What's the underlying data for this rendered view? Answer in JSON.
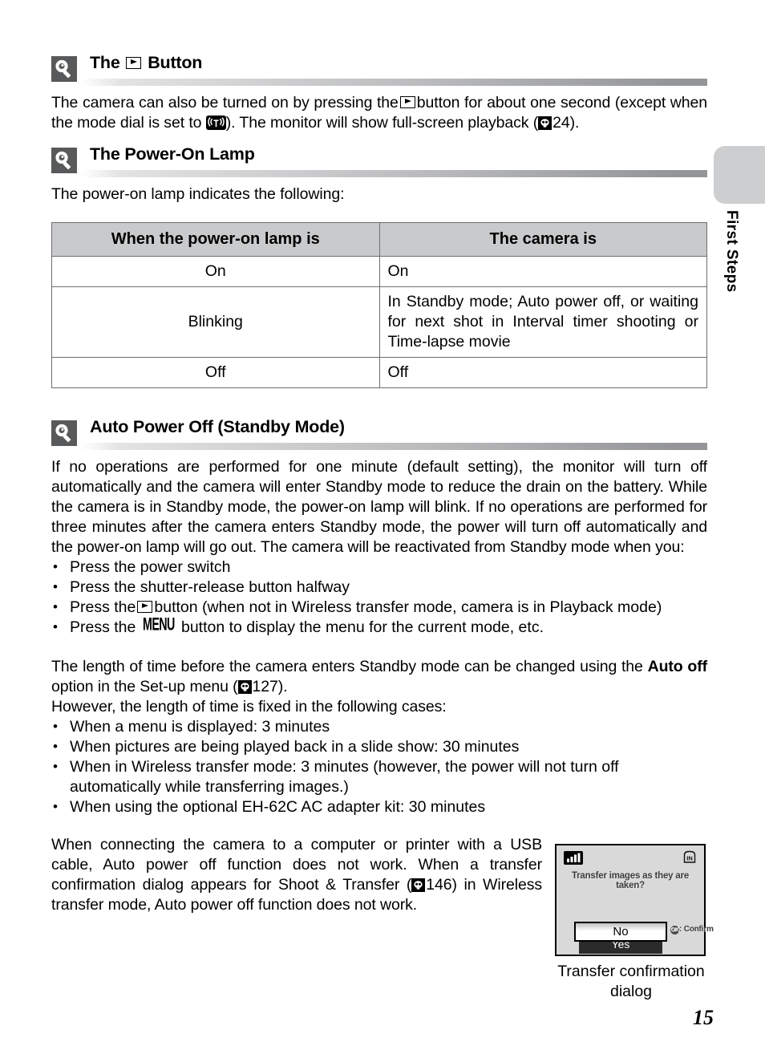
{
  "page": {
    "number": "15",
    "edge_tab_label": "First Steps"
  },
  "sections": [
    {
      "id": "play-button",
      "icon": "tip-bulb-icon",
      "title_pre": "The",
      "title_icon": "play-button-icon",
      "title_post": "Button",
      "paragraph_parts": {
        "p1": "The camera can also be turned on by pressing the",
        "p2": "button for about one second (except when the mode dial is set to",
        "p3": "). The monitor will show full-screen playback (",
        "ref": "24",
        "p4": ")."
      }
    },
    {
      "id": "power-on-lamp",
      "icon": "tip-bulb-icon",
      "title": "The Power-On Lamp",
      "intro": "The power-on lamp indicates the following:"
    },
    {
      "id": "auto-power-off",
      "icon": "tip-bulb-icon",
      "title": "Auto Power Off (Standby Mode)"
    }
  ],
  "lamp_table": {
    "headers": [
      "When the power-on lamp is",
      "The camera is"
    ],
    "rows": [
      [
        "On",
        "On"
      ],
      [
        "Blinking",
        "In Standby mode; Auto power off, or waiting for next shot in Interval timer shooting or Time-lapse movie"
      ],
      [
        "Off",
        "Off"
      ]
    ]
  },
  "auto_power_off": {
    "paragraph1": "If no operations are performed for one minute (default setting), the monitor will turn off automatically and the camera will enter Standby mode to reduce the drain on the battery. While the camera is in Standby mode, the power-on lamp will blink. If no operations are performed for three minutes after the camera enters Standby mode, the power will turn off automatically and the power-on lamp will go out. The camera will be reactivated from Standby mode when you:",
    "reactivate_bullets": [
      {
        "text": "Press the power switch"
      },
      {
        "text": "Press the shutter-release button halfway"
      },
      {
        "pre": "Press the",
        "icon": "play-button-icon",
        "post": "button (when not in Wireless transfer mode, camera is in Playback mode)"
      },
      {
        "pre": "Press the",
        "icon": "menu-button-icon",
        "menu_label": "MENU",
        "post": "button to display the menu for the current mode, etc."
      }
    ],
    "paragraph2_a": "The length of time before the camera enters Standby mode can be changed using the",
    "paragraph2_bold": "Auto off",
    "paragraph2_b": "option in the Set-up menu (",
    "paragraph2_ref": "127",
    "paragraph2_c": ").",
    "paragraph3": "However, the length of time is fixed in the following cases:",
    "fixed_bullets": [
      "When a menu is displayed: 3 minutes",
      "When pictures are being played back in a slide show: 30 minutes",
      "When in Wireless transfer mode: 3 minutes (however, the power will not turn off automatically while transferring images.)",
      "When using the optional EH-62C AC adapter kit: 30 minutes"
    ],
    "paragraph4_a": "When connecting the camera to a computer or printer with a USB cable, Auto power off function does not work. When a transfer confirmation dialog appears for Shoot & Transfer (",
    "paragraph4_ref": "146",
    "paragraph4_b": ") in Wireless transfer mode, Auto power off function does not work."
  },
  "figure": {
    "lcd": {
      "signal_icon": "signal-strength-icon",
      "memory_icon": "internal-memory-icon",
      "message": "Transfer images as they are taken?",
      "option_selected": "No",
      "option_other": "Yes",
      "confirm_hint": "OK",
      "confirm_text": ": Confirm"
    },
    "caption": "Transfer confirmation dialog"
  },
  "colors": {
    "icon_badge": "#58595b",
    "table_header": "#c9cacc",
    "table_border": "#6d6e71",
    "edge_tab": "#cdced0",
    "lcd_background": "#d9d9d9"
  }
}
